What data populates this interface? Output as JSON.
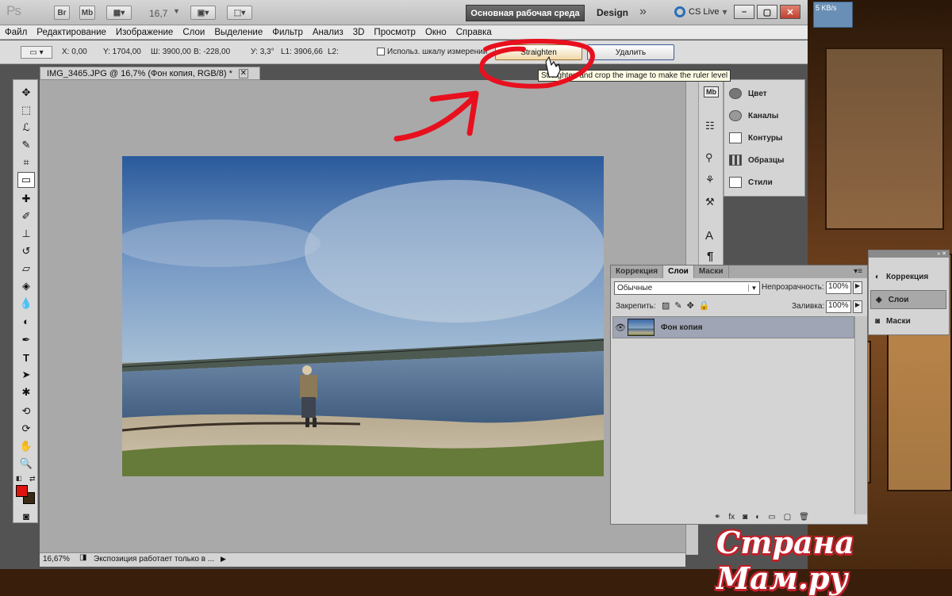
{
  "appbar": {
    "logo": "Ps",
    "bridge": "Br",
    "minibridge": "Mb",
    "zoom": "16,7",
    "workspace": "Основная рабочая среда",
    "design": "Design",
    "overflow": "»",
    "cslive": "CS Live"
  },
  "menu": [
    "Файл",
    "Редактирование",
    "Изображение",
    "Слои",
    "Выделение",
    "Фильтр",
    "Анализ",
    "3D",
    "Просмотр",
    "Окно",
    "Справка"
  ],
  "options": {
    "x": "X: 0,00",
    "y": "Y: 1704,00",
    "w": "Ш: 3900,00",
    "h": "В: -228,00",
    "angle": "У: 3,3°",
    "l1": "L1: 3906,66",
    "l2": "L2:",
    "use_scale": "Использ. шкалу измерений",
    "straighten": "Straighten",
    "delete": "Удалить"
  },
  "tooltip": "Straighten and crop the image to make the ruler level",
  "document": {
    "tab_title": "IMG_3465.JPG @ 16,7% (Фон копия, RGB/8) *",
    "zoom_status": "16,67%",
    "status_text": "Экспозиция работает только в ..."
  },
  "dock": {
    "items": [
      "Цвет",
      "Каналы",
      "Контуры",
      "Образцы",
      "Стили"
    ],
    "icons": [
      "Mb",
      "A",
      "¶"
    ]
  },
  "layers_panel": {
    "tabs": [
      "Коррекция",
      "Слои",
      "Маски"
    ],
    "active_tab": "Слои",
    "blend_mode": "Обычные",
    "opacity_label": "Непрозрачность:",
    "opacity": "100%",
    "lock_label": "Закрепить:",
    "fill_label": "Заливка:",
    "fill": "100%",
    "layers": [
      {
        "name": "Фон копия",
        "visible": true
      }
    ]
  },
  "mini_panel": {
    "items": [
      "Коррекция",
      "Слои",
      "Маски"
    ],
    "selected": "Слои"
  },
  "network": {
    "speed": "5 KB/s"
  },
  "watermark": "Страна Мам.ру",
  "colors": {
    "foreground": "#e0140e",
    "background": "#3a2a14",
    "annotation": "#e8101e"
  }
}
